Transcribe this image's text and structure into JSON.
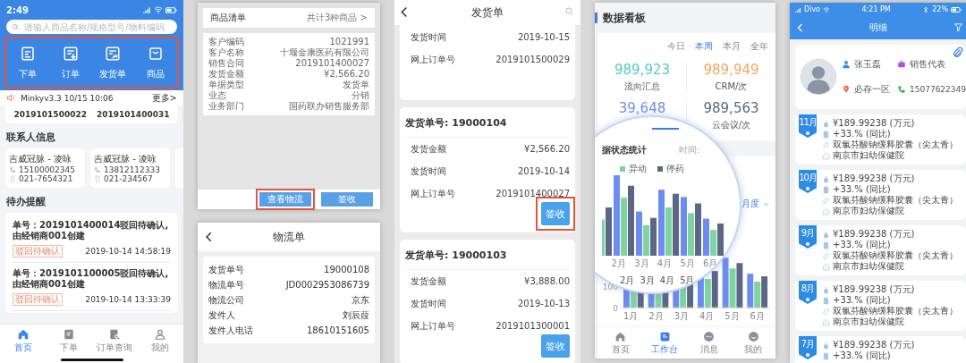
{
  "home_screen": {
    "status_time": "2:49",
    "search": {
      "placeholder": "请输入商品名称/规格型号/物料编码"
    },
    "shortcuts_highlighted": true,
    "shortcuts": [
      {
        "label": "下单"
      },
      {
        "label": "订单"
      },
      {
        "label": "发货单"
      },
      {
        "label": "商品"
      }
    ],
    "notice": {
      "text": "Minkyv3.3 10/15 10:06",
      "more": "更多>"
    },
    "order_numbers": [
      "2019101500022",
      "2019101400031"
    ],
    "contacts_title": "联系人信息",
    "contacts": [
      {
        "name": "吉威冠脉 - 凌咏",
        "mobile": "15100002345",
        "phone": "021-7654321"
      },
      {
        "name": "吉威冠脉 - 凌咏",
        "mobile": "13812112333",
        "phone": "021-234567"
      }
    ],
    "reminders_title": "待办提醒",
    "reminders": [
      {
        "text": "单号：2019101400014驳回待确认,由经销商001创建",
        "tag": "驳回待确认",
        "time": "2019-10-14 14:58:19"
      },
      {
        "text": "单号：2019101100005驳回待确认,由经销商001创建",
        "tag": "驳回待确认",
        "time": "2019-10-14 13:33:39"
      }
    ],
    "tabs": [
      {
        "label": "首页",
        "selected": true
      },
      {
        "label": "下单",
        "selected": false
      },
      {
        "label": "订单查询",
        "selected": false
      },
      {
        "label": "我的",
        "selected": false
      }
    ]
  },
  "shipment_detail": {
    "list_title": "商品清单",
    "list_count": "共计3种商品 >",
    "fields": [
      {
        "label": "客户编码",
        "value": "1021991"
      },
      {
        "label": "客户名称",
        "value": "十堰金康医药有限公司"
      },
      {
        "label": "销售合同",
        "value": "2019101400027"
      },
      {
        "label": "发货金额",
        "value": "¥2,566.20"
      },
      {
        "label": "单据类型",
        "value": "发货单"
      },
      {
        "label": "业态",
        "value": "分销"
      },
      {
        "label": "业务部门",
        "value": "国药联办销售服务部"
      }
    ],
    "buttons": [
      {
        "label": "查看物流",
        "highlighted": true
      },
      {
        "label": "签收",
        "highlighted": false
      }
    ]
  },
  "logistics": {
    "title": "物流单",
    "fields": [
      {
        "label": "发货单号",
        "value": "19000108"
      },
      {
        "label": "物流单号",
        "value": "JD0002953086739"
      },
      {
        "label": "物流公司",
        "value": "京东"
      },
      {
        "label": "发件人",
        "value": "刘辰葭"
      },
      {
        "label": "发件人电话",
        "value": "18610151605"
      }
    ]
  },
  "shipment_list": {
    "title": "发货单",
    "cards": [
      {
        "fields": [
          {
            "label": "发货时间",
            "value": "2019-10-15"
          },
          {
            "label": "网上订单号",
            "value": "2019101500029"
          }
        ]
      },
      {
        "title": "发货单号: 19000104",
        "fields": [
          {
            "label": "发货金额",
            "value": "¥2,566.20"
          },
          {
            "label": "发货时间",
            "value": "2019-10-14"
          },
          {
            "label": "网上订单号",
            "value": "2019101400027"
          }
        ],
        "button": {
          "label": "签收",
          "highlighted": true
        }
      },
      {
        "title": "发货单号: 19000103",
        "fields": [
          {
            "label": "发货金额",
            "value": "¥3,888.00"
          },
          {
            "label": "发货时间",
            "value": "2019-10-13"
          },
          {
            "label": "网上订单号",
            "value": "2019101300001"
          }
        ],
        "button": {
          "label": "签收",
          "highlighted": false
        }
      }
    ]
  },
  "dashboard": {
    "title": "数据看板",
    "periods": [
      {
        "label": "今日",
        "selected": false
      },
      {
        "label": "本周",
        "selected": true
      },
      {
        "label": "本月",
        "selected": false
      },
      {
        "label": "全年",
        "selected": false
      }
    ],
    "stats": [
      {
        "value": "989,923",
        "label": "流向汇总",
        "color": "#4ecbc4"
      },
      {
        "value": "989,949",
        "label": "CRM/次",
        "color": "#f5a55a"
      },
      {
        "value": "39,648",
        "color": "#6e8cf0"
      },
      {
        "value": "989,563",
        "label": "云会议/次",
        "color": "#5c6580"
      }
    ],
    "period_select": "月度",
    "y_ticks": [
      "100",
      "0"
    ],
    "x_labels": [
      "1月",
      "2月",
      "3月",
      "4月",
      "5月",
      "6月"
    ],
    "zoom": {
      "chart_title": "据状态统计",
      "time_label": "时间:",
      "legend": [
        {
          "label": "异动",
          "color": "#7fd3a0"
        },
        {
          "label": "停药",
          "color": "#5b6785"
        }
      ],
      "x_labels": [
        "2月",
        "3月",
        "4月",
        "5月",
        "6月"
      ],
      "lower_labels": [
        "2月",
        "3月",
        "4月",
        "5月"
      ]
    },
    "tabs": [
      {
        "label": "首页",
        "selected": false
      },
      {
        "label": "工作台",
        "selected": true
      },
      {
        "label": "消息",
        "selected": false
      },
      {
        "label": "我的",
        "selected": false
      }
    ]
  },
  "detail": {
    "carrier": "Divo",
    "time": "4:21 PM",
    "battery": "22%",
    "title": "明细",
    "profile": {
      "name": "张玉磊",
      "role": "销售代表",
      "area": "必存一区",
      "phone": "15077622349"
    },
    "months": [
      {
        "month": "11月",
        "amount": "¥189.99238 (万元)",
        "growth": "+33.% (同比)",
        "product": "双氯芬酸钠缓释胶囊（尖太青）",
        "hospital": "南京市妇幼保健院"
      },
      {
        "month": "10月",
        "amount": "¥189.99238 (万元)",
        "growth": "+33.% (同比)",
        "product": "双氯芬酸钠缓释胶囊（尖太青）",
        "hospital": "南京市妇幼保健院"
      },
      {
        "month": "9月",
        "amount": "¥189.99238 (万元)",
        "growth": "+33.% (同比)",
        "product": "双氯芬酸钠缓释胶囊（尖太青）",
        "hospital": "南京市妇幼保健院"
      },
      {
        "month": "8月",
        "amount": "¥189.99238 (万元)",
        "growth": "+33.% (同比)",
        "product": "双氯芬酸钠缓释胶囊（尖太青）",
        "hospital": "南京市妇幼保健院"
      },
      {
        "month": "7月",
        "amount": "¥189.99238 (万元)",
        "growth": "+33.% (同比)"
      }
    ]
  }
}
